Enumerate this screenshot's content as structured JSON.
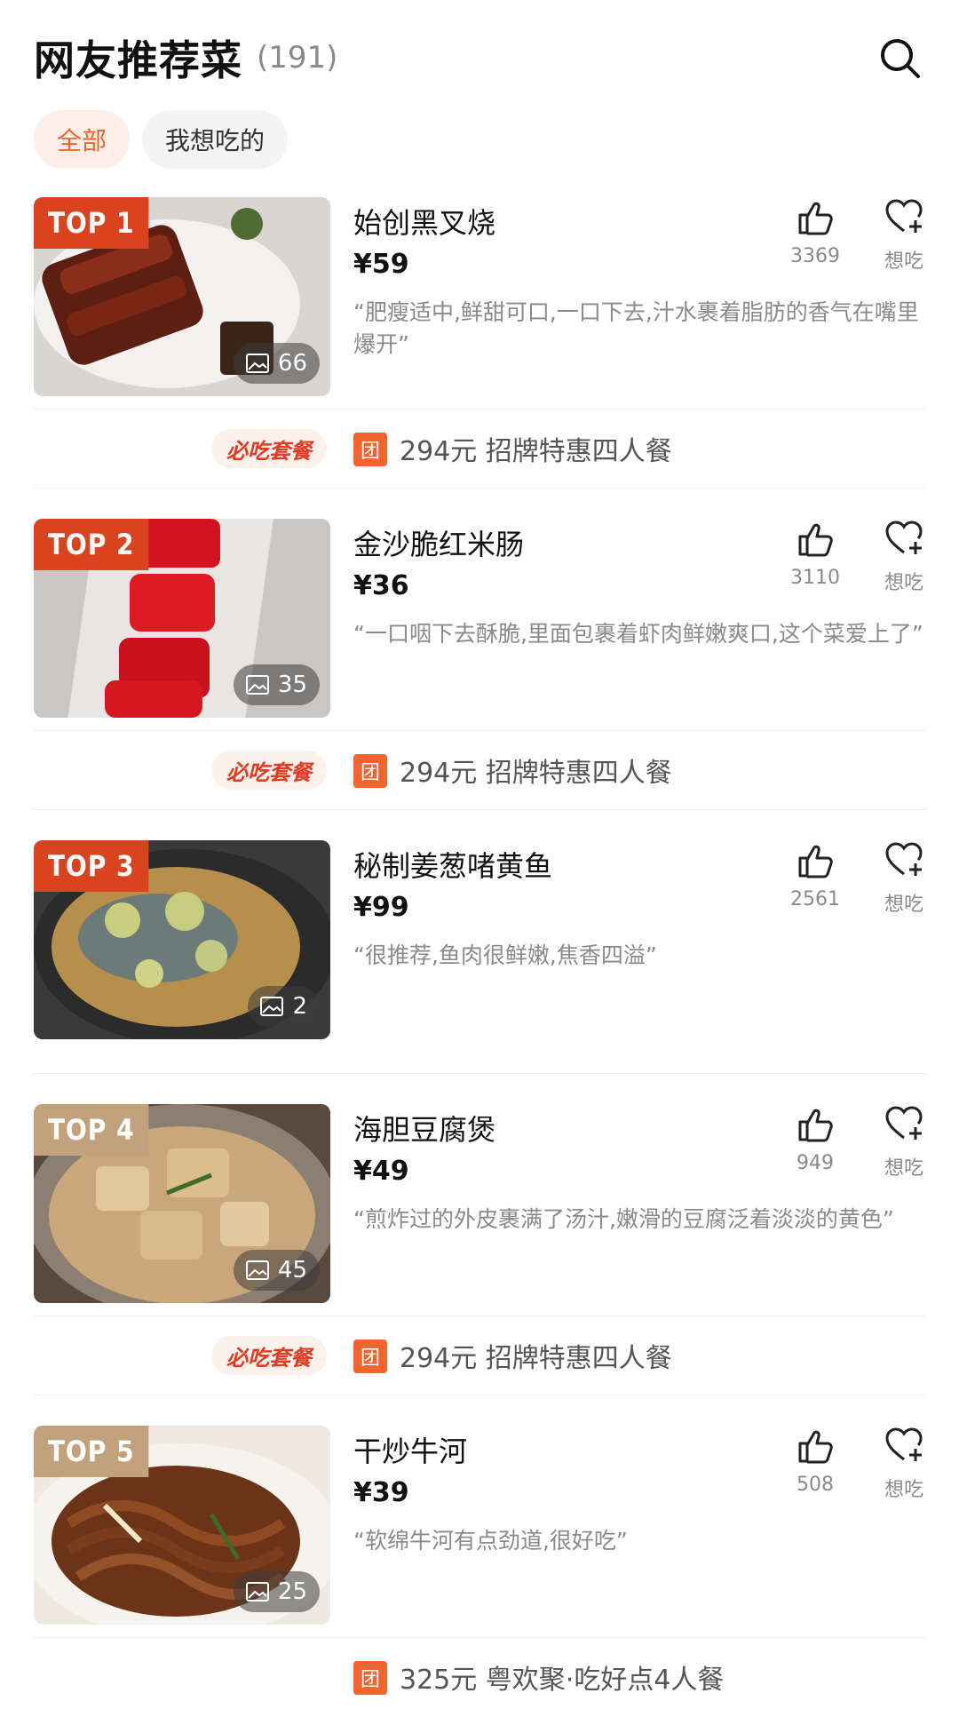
{
  "header": {
    "title": "网友推荐菜",
    "count": "(191)"
  },
  "filters": [
    {
      "label": "全部"
    },
    {
      "label": "我想吃的"
    }
  ],
  "dishes": [
    {
      "rank": "TOP 1",
      "name": "始创黑叉烧",
      "price": "¥59",
      "review": "“肥瘦适中,鲜甜可口,一口下去,汁水裹着脂肪的香气在嘴里爆开”",
      "likes": "3369",
      "want_label": "想吃",
      "photos": "66",
      "combo": {
        "logo": "必吃套餐",
        "tuan": "团",
        "text": "294元 招牌特惠四人餐"
      }
    },
    {
      "rank": "TOP 2",
      "name": "金沙脆红米肠",
      "price": "¥36",
      "review": "“一口咽下去酥脆,里面包裹着虾肉鲜嫩爽口,这个菜爱上了”",
      "likes": "3110",
      "want_label": "想吃",
      "photos": "35",
      "combo": {
        "logo": "必吃套餐",
        "tuan": "团",
        "text": "294元 招牌特惠四人餐"
      }
    },
    {
      "rank": "TOP 3",
      "name": "秘制姜葱啫黄鱼",
      "price": "¥99",
      "review": "“很推荐,鱼肉很鲜嫩,焦香四溢”",
      "likes": "2561",
      "want_label": "想吃",
      "photos": "2"
    },
    {
      "rank": "TOP 4",
      "name": "海胆豆腐煲",
      "price": "¥49",
      "review": "“煎炸过的外皮裹满了汤汁,嫩滑的豆腐泛着淡淡的黄色”",
      "likes": "949",
      "want_label": "想吃",
      "photos": "45",
      "combo": {
        "logo": "必吃套餐",
        "tuan": "团",
        "text": "294元 招牌特惠四人餐"
      }
    },
    {
      "rank": "TOP 5",
      "name": "干炒牛河",
      "price": "¥39",
      "review": "“软绵牛河有点劲道,很好吃”",
      "likes": "508",
      "want_label": "想吃",
      "photos": "25",
      "combo": {
        "tuan": "团",
        "text": "325元 粤欢聚·吃好点4人餐"
      }
    }
  ],
  "colors": {
    "accent": "#f2632d",
    "badge_red": "#d9431f",
    "badge_tan": "#c2a27c"
  },
  "icons": [
    "search-icon",
    "thumbs-up-icon",
    "heart-plus-icon",
    "image-icon"
  ]
}
